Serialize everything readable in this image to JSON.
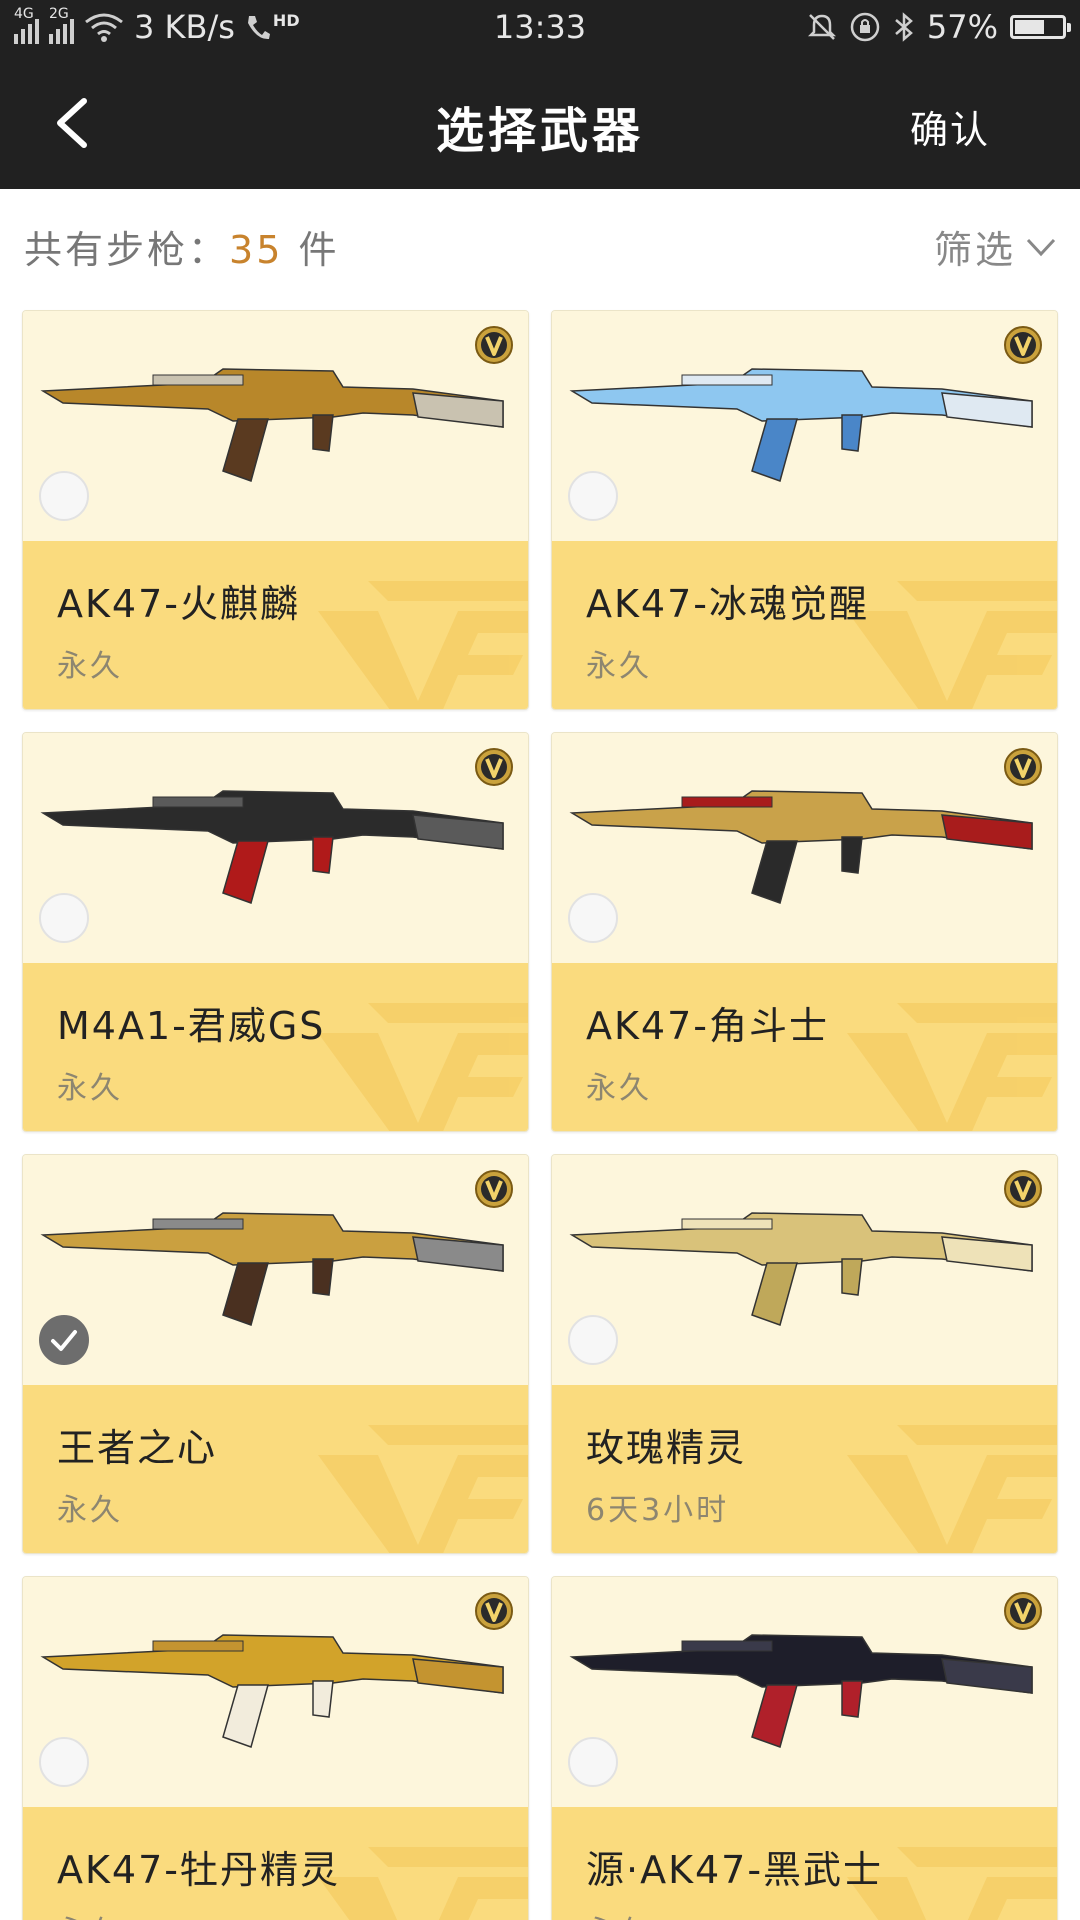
{
  "status_bar": {
    "network_1": "4G",
    "network_2": "2G",
    "speed": "3 KB/s",
    "hd": "HD",
    "time": "13:33",
    "battery": "57%",
    "battery_level": 0.57
  },
  "header": {
    "title": "选择武器",
    "confirm_label": "确认"
  },
  "summary": {
    "prefix": "共有步枪：",
    "count": "35",
    "suffix": " 件",
    "filter_label": "筛选"
  },
  "colors": {
    "bar": "#212121",
    "card_top": "#fdf6dc",
    "card_bottom": "#fadb7e",
    "count_accent": "#c8832d"
  },
  "weapons": [
    {
      "name": "AK47-火麒麟",
      "duration": "永久",
      "selected": false,
      "icon": "ak47-fire-qilin-image"
    },
    {
      "name": "AK47-冰魂觉醒",
      "duration": "永久",
      "selected": false,
      "icon": "ak47-ice-soul-image"
    },
    {
      "name": "M4A1-君威GS",
      "duration": "永久",
      "selected": false,
      "icon": "m4a1-junwei-image"
    },
    {
      "name": "AK47-角斗士",
      "duration": "永久",
      "selected": false,
      "icon": "ak47-gladiator-image"
    },
    {
      "name": "王者之心",
      "duration": "永久",
      "selected": true,
      "icon": "king-heart-image"
    },
    {
      "name": "玫瑰精灵",
      "duration": "6天3小时",
      "selected": false,
      "icon": "rose-spirit-image"
    },
    {
      "name": "AK47-牡丹精灵",
      "duration": "永久",
      "selected": false,
      "icon": "ak47-peony-image"
    },
    {
      "name": "源·AK47-黑武士",
      "duration": "永久",
      "selected": false,
      "icon": "ak47-black-warrior-image"
    }
  ]
}
